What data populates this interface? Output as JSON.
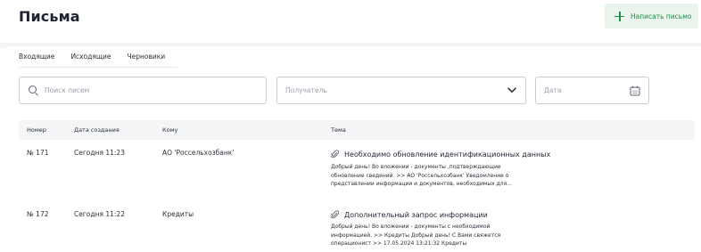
{
  "header": {
    "title": "Письма",
    "write_button_label": "Написать письмо"
  },
  "tabs": [
    {
      "label": "Входящие",
      "active": false
    },
    {
      "label": "Исходящие",
      "active": false
    },
    {
      "label": "Черновики",
      "active": true
    }
  ],
  "filters": {
    "search_placeholder": "Поиск писем",
    "recipient_placeholder": "Получатель",
    "date_placeholder": "Дата"
  },
  "table": {
    "columns": [
      "Номер",
      "Дата создания",
      "Кому",
      "Тема"
    ],
    "rows": [
      {
        "number": "№ 171",
        "created": "Сегодня 11:23",
        "to": "АО 'Россельхозбанк'",
        "subject": "Необходимо обновление идентификационных данных",
        "preview": [
          "Добрый день! Во вложении - документы ,подтверждающие",
          "обновление сведений. >> АО 'Россельхозбанк' Уведомление о",
          "представлении информации и документов, необходимых для..."
        ]
      },
      {
        "number": "№ 172",
        "created": "Сегодня 11:22",
        "to": "Кредиты",
        "subject": "Дополнительный запрос информации",
        "preview": [
          "Добрый день! Во вложении - документы с необходимой",
          "информацией. >> Кредиты Добрый день! С Вами свяжется",
          "операционист >> 17.05.2024 13:21:32 Кредиты"
        ]
      }
    ]
  },
  "colors": {
    "accent": "#1f8f4a",
    "accent_bg": "#e8f4ec",
    "table_header_bg": "#f4f5f7",
    "field_border": "#c8ccd3"
  },
  "icons": [
    "plus-icon",
    "search-icon",
    "chevron-down-icon",
    "calendar-icon",
    "paperclip-icon"
  ]
}
